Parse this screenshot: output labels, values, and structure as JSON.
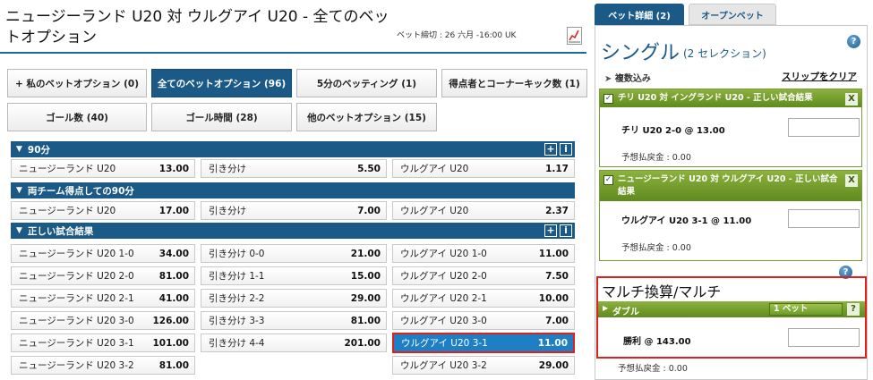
{
  "header": {
    "title": "ニュージーランド U20 対 ウルグアイ U20 - 全てのベットオプション",
    "deadline": "ベット締切 : 26 六月 -16:00 UK"
  },
  "options": [
    "+ 私のベットオプション (0)",
    "全てのベットオプション (96)",
    "5分のベッティング (1)",
    "得点者とコーナーキック数 (1)",
    "ゴール数 (40)",
    "ゴール時間 (28)",
    "他のベットオプション (15)"
  ],
  "sections": {
    "s90": {
      "title": "90分"
    },
    "both": {
      "title": "両チーム得点しての90分"
    },
    "correct": {
      "title": "正しい試合結果"
    }
  },
  "markets": {
    "s90": [
      {
        "sel": "ニュージーランド U20",
        "odd": "13.00"
      },
      {
        "sel": "引き分け",
        "odd": "5.50"
      },
      {
        "sel": "ウルグアイ U20",
        "odd": "1.17"
      }
    ],
    "both": [
      {
        "sel": "ニュージーランド U20",
        "odd": "17.00"
      },
      {
        "sel": "引き分け",
        "odd": "7.00"
      },
      {
        "sel": "ウルグアイ U20",
        "odd": "2.37"
      }
    ],
    "correct": [
      [
        {
          "sel": "ニュージーランド U20 1-0",
          "odd": "34.00"
        },
        {
          "sel": "引き分け 0-0",
          "odd": "21.00"
        },
        {
          "sel": "ウルグアイ U20 1-0",
          "odd": "11.00"
        }
      ],
      [
        {
          "sel": "ニュージーランド U20 2-0",
          "odd": "81.00"
        },
        {
          "sel": "引き分け 1-1",
          "odd": "15.00"
        },
        {
          "sel": "ウルグアイ U20 2-0",
          "odd": "7.50"
        }
      ],
      [
        {
          "sel": "ニュージーランド U20 2-1",
          "odd": "41.00"
        },
        {
          "sel": "引き分け 2-2",
          "odd": "29.00"
        },
        {
          "sel": "ウルグアイ U20 2-1",
          "odd": "10.00"
        }
      ],
      [
        {
          "sel": "ニュージーランド U20 3-0",
          "odd": "126.00"
        },
        {
          "sel": "引き分け 3-3",
          "odd": "81.00"
        },
        {
          "sel": "ウルグアイ U20 3-0",
          "odd": "7.00"
        }
      ],
      [
        {
          "sel": "ニュージーランド U20 3-1",
          "odd": "101.00"
        },
        {
          "sel": "引き分け 4-4",
          "odd": "201.00"
        },
        {
          "sel": "ウルグアイ U20 3-1",
          "odd": "11.00"
        }
      ],
      [
        {
          "sel": "ニュージーランド U20 3-2",
          "odd": "81.00"
        },
        null,
        {
          "sel": "ウルグアイ U20 3-2",
          "odd": "29.00"
        }
      ]
    ]
  },
  "slip": {
    "tabs": [
      "ベット詳細 (2)",
      "オープンベット"
    ],
    "single_title": "シングル",
    "single_count": "(2 セレクション)",
    "collapse": "複数込み",
    "clear": "スリップをクリア",
    "selections": [
      {
        "header": "チリ U20 対 イングランド U20 - 正しい試合結果",
        "pick": "チリ U20 2-0 @ 13.00",
        "payout": "予想払戻金 : 0.00"
      },
      {
        "header": "ニュージーランド U20 対 ウルグアイ U20 - 正しい試合結果",
        "pick": "ウルグアイ U20 3-1 @ 11.00",
        "payout": "予想払戻金 : 0.00"
      }
    ],
    "multi": {
      "title": "マルチ換算/マルチ",
      "double": "ダブル",
      "bet_count": "1 ベット",
      "pick": "勝利 @ 143.00",
      "payout": "予想払戻金 : 0.00"
    }
  }
}
